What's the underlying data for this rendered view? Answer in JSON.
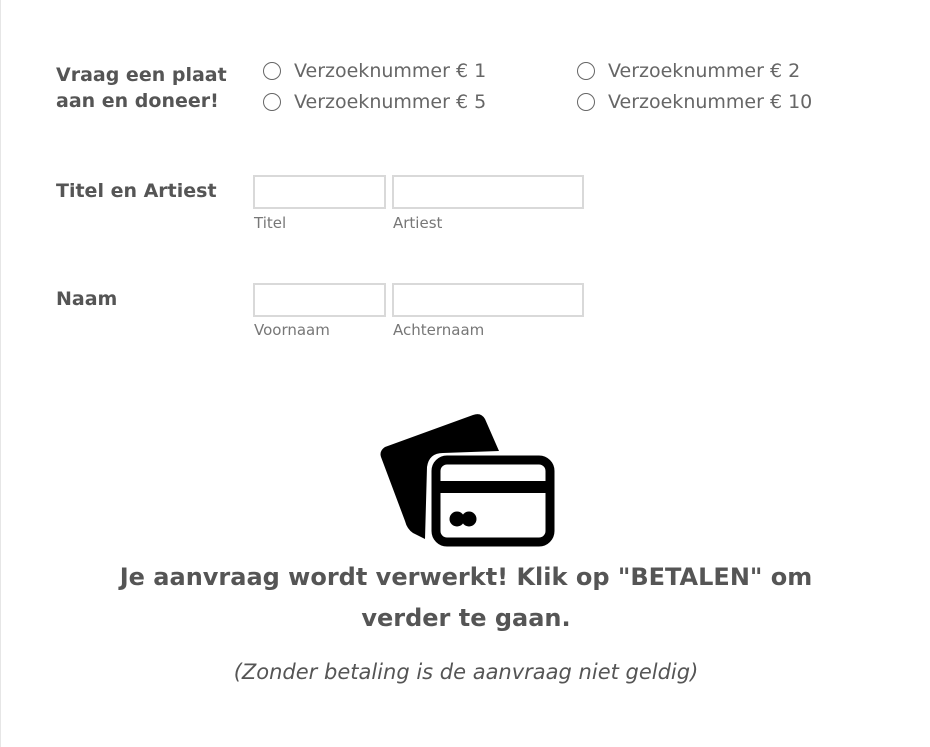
{
  "donation": {
    "label_line1": "Vraag een plaat",
    "label_line2": "aan en doneer!",
    "options": [
      "Verzoeknummer € 1",
      "Verzoeknummer € 2",
      "Verzoeknummer € 5",
      "Verzoeknummer € 10"
    ]
  },
  "title_artist": {
    "label": "Titel en Artiest",
    "title_sublabel": "Titel",
    "artist_sublabel": "Artiest"
  },
  "name": {
    "label": "Naam",
    "first_sublabel": "Voornaam",
    "last_sublabel": "Achternaam"
  },
  "message": {
    "line1": "Je aanvraag wordt verwerkt! Klik op \"BETALEN\" om",
    "line2": "verder te gaan.",
    "note": "(Zonder betaling is de aanvraag niet geldig)"
  },
  "icons": {
    "payment": "credit-card-icon"
  }
}
